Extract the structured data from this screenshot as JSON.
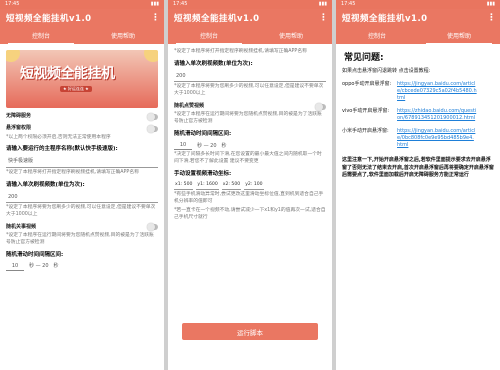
{
  "status": {
    "time": "17:45",
    "battery": "▮▮▮"
  },
  "app": {
    "title": "短视频全能挂机v1.0"
  },
  "tabs": [
    "控制台",
    "使用帮助"
  ],
  "screen1": {
    "banner_title": "短视频全能挂机",
    "banner_sub": "★ 好运连连 ★",
    "switch1": "无障碍服务",
    "switch2": "悬浮窗权限",
    "note1": "*以上两个权限必须开启,否则无法正常使用本程序",
    "app_heading": "请输入要运行的主程序名称(默认快手极速版):",
    "app_input": "快手极速版",
    "app_note": "*设定了本程序将打开指定程序刷视频挂机,请填写正确APP名称",
    "count_heading": "请输入单次刷视频数(单位为次):",
    "count_value": "200",
    "count_note": "*设定了本程序将要为您刷多少的视频,可以任意设定,但是建议不要单次大于1000以上",
    "rand_switch": "随机关事视频",
    "rand_note": "*设定了本程序在运行期间将要为您随机点赞视频,目的被是为了活跃账号防止官方被检测",
    "interval_heading": "随机滑动时间间隔区间:",
    "range_from": "10",
    "range_sep": "秒 — 20",
    "range_unit": "秒"
  },
  "screen2": {
    "top_note": "*设定了本程序将打开指定程序刷视频挂机,请填写正确APP名称",
    "count_heading": "请输入单次刷视频数(单位为次):",
    "count_value": "200",
    "count_note": "*设定了本程序将要为您刷多少的视频,可以任意设定,但是建议不要单次大于1000以上",
    "like_switch": "随机点赞视频",
    "like_note": "*设定了本程序在运行期间将要为您随机点赞视频,目的被是为了活跃账号防止官方被检测",
    "interval_heading": "随机滑动时间间隔区间:",
    "range_from": "10",
    "range_sep": "秒 — 20",
    "range_unit": "秒",
    "interval_note": "*决定了间隔多长时间下滑,在您设置的最小最大值之间内随机取一个时间下滑,若您不了解此设置 建议不要变更",
    "coord_heading": "手动设置视频滑动坐标:",
    "coords": [
      "x1: 500",
      "y1: 1600",
      "x2: 500",
      "y2: 100"
    ],
    "coord_note": "*有些手机滑动异常时,尝试更改这里滑动坐标位值,直到机到适合自己手机分辨率的值即可",
    "coord_note2": "*若一直卡在一个视频不动,请尝试减少一下x1和y1的值再次一试,适合自己手机尺寸就行",
    "run_button": "运行脚本"
  },
  "screen3": {
    "faq_title": "常见问题:",
    "faq_intro": "如果点击悬浮窗闪退跳转 点击设置教程:",
    "items": [
      {
        "k": "oppo手动开启悬浮窗:",
        "u": "https://jingyan.baidu.com/article/cbcede07329c5a02f4b5480.html"
      },
      {
        "k": "vivo手动开启悬浮窗:",
        "u": "https://zhidao.baidu.com/question/678913451201900012.html"
      },
      {
        "k": "小米手动开启悬浮窗:",
        "u": "https://jingyan.baidu.com/article/0bc808fc0e9e95bd485b9e4.html"
      }
    ],
    "bottom_note": "这里注意一下,开始开启悬浮窗之后,若软件里面提示要求去开启悬浮窗了否则无法了结束去开启,首次开启悬浮窗后再将要确定开启悬浮窗后需要点了,软件里面加载后开启无障碍服务方能正常运行"
  },
  "colors": {
    "accent": "#ea7762"
  }
}
